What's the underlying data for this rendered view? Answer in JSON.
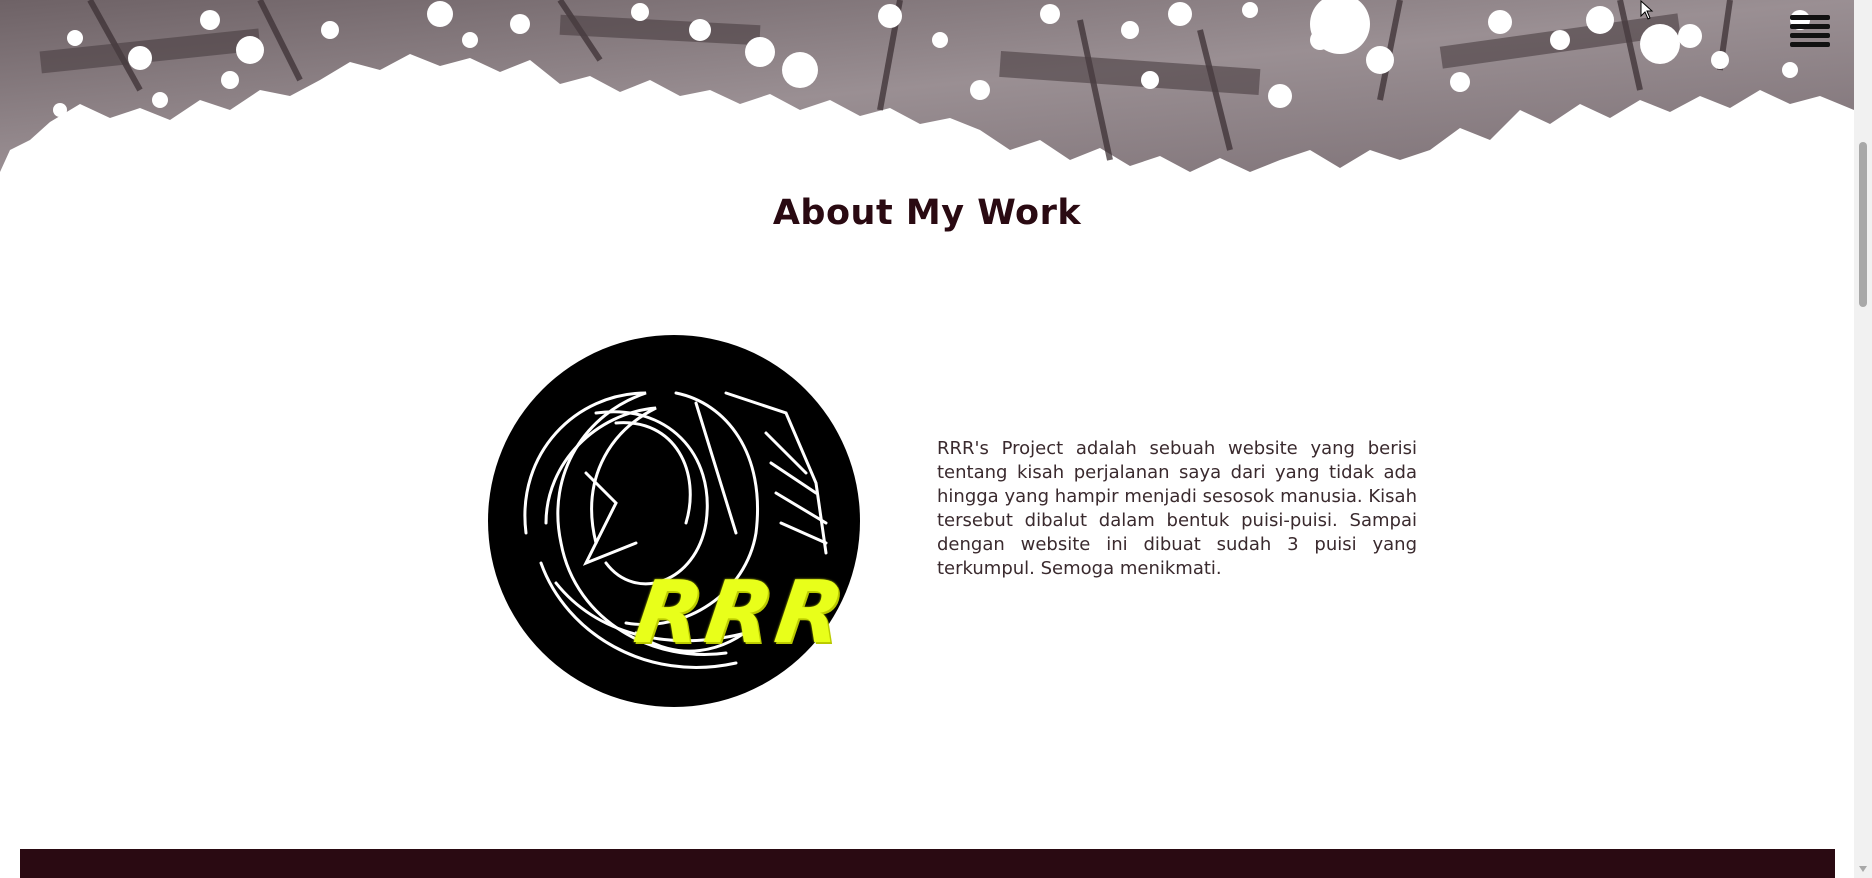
{
  "page": {
    "title": "About My Work"
  },
  "about": {
    "description": "RRR's Project adalah sebuah website yang berisi tentang kisah perjalanan saya dari yang tidak ada hingga yang hampir menjadi sesosok manusia. Kisah tersebut dibalut dalam bentuk puisi-puisi. Sampai dengan website ini dibuat sudah 3 puisi yang terkumpul. Semoga menikmati.",
    "logo_text": "RRR"
  },
  "icons": {
    "menu": "hamburger-menu-icon",
    "scroll_down": "chevron-down-icon"
  },
  "colors": {
    "title": "#2a0a12",
    "footer": "#2a0a12",
    "logo_accent": "#e8ff1a"
  }
}
